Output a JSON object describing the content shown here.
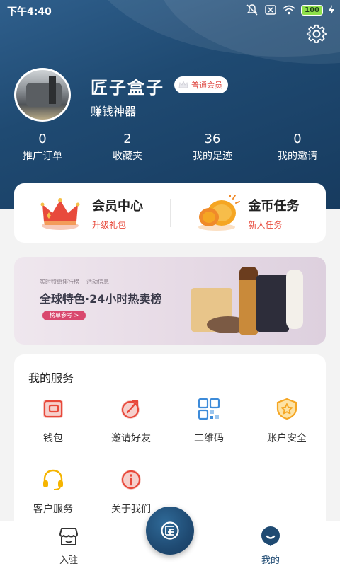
{
  "status_bar": {
    "time": "下午4:40",
    "battery": "100"
  },
  "profile": {
    "name": "匠子盒子",
    "badge": "普通会员",
    "subtitle": "赚钱神器"
  },
  "stats": [
    {
      "value": "0",
      "label": "推广订单"
    },
    {
      "value": "2",
      "label": "收藏夹"
    },
    {
      "value": "36",
      "label": "我的足迹"
    },
    {
      "value": "0",
      "label": "我的邀请"
    }
  ],
  "promo": [
    {
      "title": "会员中心",
      "subtitle": "升级礼包",
      "icon": "crown-icon"
    },
    {
      "title": "金币任务",
      "subtitle": "新人任务",
      "icon": "gold-coin-icon"
    }
  ],
  "banner": {
    "tabs": [
      "实时特惠排行榜",
      "活动信息"
    ],
    "title": "全球特色·24小时热卖榜",
    "button": "榜单参考 >"
  },
  "services": {
    "title": "我的服务",
    "items": [
      {
        "label": "钱包",
        "icon": "wallet-icon"
      },
      {
        "label": "邀请好友",
        "icon": "invite-icon"
      },
      {
        "label": "二维码",
        "icon": "qr-code-icon"
      },
      {
        "label": "账户安全",
        "icon": "shield-icon"
      },
      {
        "label": "客户服务",
        "icon": "headset-icon"
      },
      {
        "label": "关于我们",
        "icon": "info-icon"
      }
    ]
  },
  "tabbar": {
    "items": [
      {
        "label": "入驻",
        "icon": "store-icon"
      },
      {
        "label": "我的",
        "icon": "profile-icon"
      }
    ],
    "center_icon": "logo-icon"
  },
  "colors": {
    "header": "#1f4a72",
    "accent_red": "#e8483a",
    "accent_gold": "#f5a623",
    "active_tab": "#1f4a72"
  }
}
